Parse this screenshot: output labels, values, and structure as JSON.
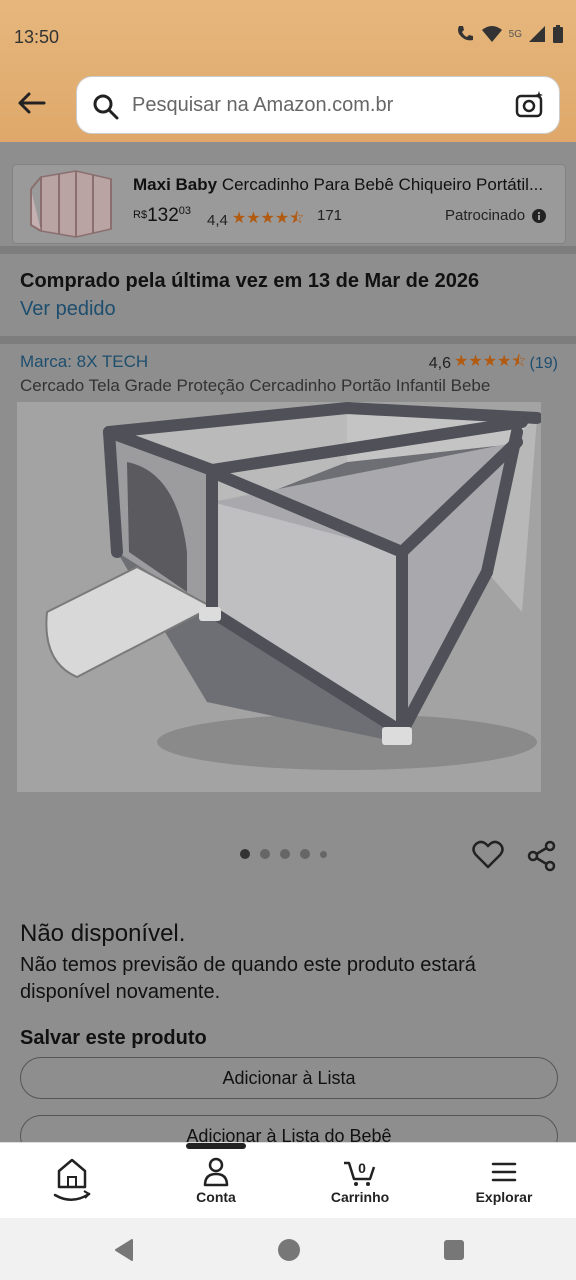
{
  "status_bar": {
    "time": "13:50",
    "network": "5G"
  },
  "search": {
    "placeholder": "Pesquisar na Amazon.com.br"
  },
  "sponsored": {
    "brand": "Maxi Baby",
    "title": "Cercadinho Para Bebê Chiqueiro Portátil...",
    "price_currency": "R$",
    "price_whole": "132",
    "price_cents": "03",
    "rating": "4,4",
    "review_count": "171",
    "label": "Patrocinado"
  },
  "order": {
    "purchased_text": "Comprado pela última vez em 13 de Mar de 2026",
    "view_link": "Ver pedido"
  },
  "product": {
    "brand": "Marca: 8X TECH",
    "rating": "4,6",
    "review_count": "(19)",
    "title": "Cercado Tela Grade Proteção Cercadinho Portão Infantil Bebe",
    "image_count": 5,
    "image_index": 1
  },
  "availability": {
    "heading": "Não disponível.",
    "text": "Não temos previsão de quando este produto estará disponível novamente."
  },
  "save": {
    "heading": "Salvar este produto",
    "add_list": "Adicionar à Lista",
    "add_baby_list": "Adicionar à Lista do Bebê"
  },
  "bottom_nav": {
    "account": "Conta",
    "cart": "Carrinho",
    "cart_count": "0",
    "explore": "Explorar"
  },
  "colors": {
    "header": "#e2ae70",
    "overlay": "#8e8e8e",
    "link": "#1e4e6e",
    "star": "#b15a10"
  }
}
